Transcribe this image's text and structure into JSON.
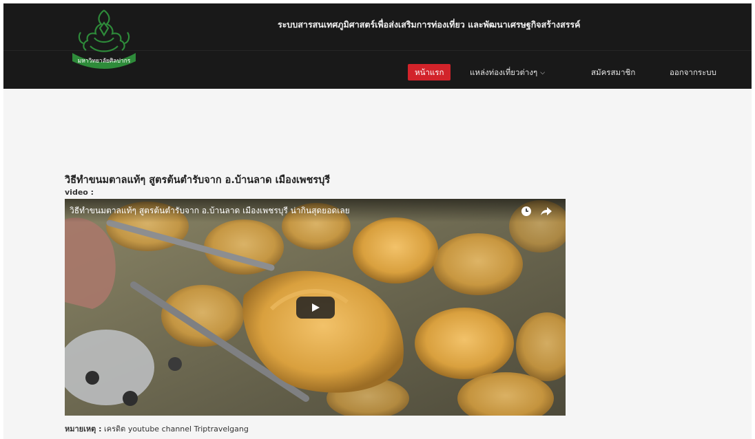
{
  "header": {
    "site_title": "ระบบสารสนเทศภูมิศาสตร์เพื่อส่งเสริมการท่องเที่ยว  และพัฒนาเศรษฐกิจสร้างสรรค์",
    "logo": {
      "icon": "university-seal-icon",
      "text": "มหาวิทยาลัยศิลปากร",
      "color": "#2e8b3a"
    }
  },
  "nav": {
    "home": "หน้าแรก",
    "attractions": "แหล่งท่องเที่ยวต่างๆ",
    "register": "สมัครสมาชิก",
    "logout": "ออกจากระบบ",
    "accent_color": "#d2232a"
  },
  "article": {
    "title": "วิธีทำขนมตาลแท้ๆ สูตรต้นตำรับจาก อ.บ้านลาด เมืองเพชรบุรี",
    "video_label": "video :",
    "video": {
      "title": "วิธีทำขนมตาลแท้ๆ สูตรต้นตำรับจาก อ.บ้านลาด เมืองเพชรบุรี น่ากินสุดยอดเลย",
      "icons": [
        "clock-icon",
        "share-icon",
        "play-icon"
      ]
    },
    "note_label": "หมายเหตุ :",
    "note_text": " เครดิต youtube channel Triptravelgang"
  }
}
